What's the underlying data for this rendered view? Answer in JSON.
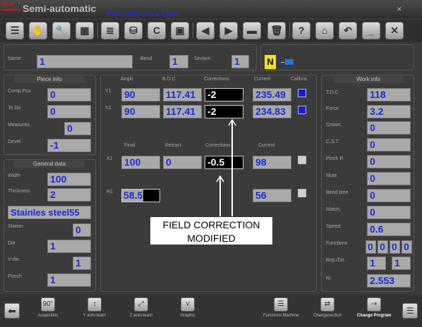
{
  "app": {
    "logo_text": "esa",
    "title": "Semi-automatic",
    "program": "PM0000 Press Start"
  },
  "toolbar": {
    "buttons": [
      "document-icon",
      "hand-icon",
      "wrench-icon",
      "calendar-icon",
      "list-icon",
      "database-icon",
      "c-icon",
      "save-icon",
      "arrow-left-icon",
      "arrow-right-icon",
      "minus-icon",
      "trash-icon",
      "help-icon",
      "home-icon",
      "undo-icon",
      "minimize-icon",
      "close-icon"
    ]
  },
  "header": {
    "name_label": "Name",
    "name_value": "1",
    "bend_label": "Bend",
    "bend_value": "1",
    "section_label": "Section",
    "section_value": "1",
    "mode_badge": "N"
  },
  "piece_info": {
    "title": "Piece info",
    "comp_pcs_label": "Comp.Pcs",
    "comp_pcs_value": "0",
    "to_do_label": "To Do",
    "to_do_value": "0",
    "measures_label": "Measures",
    "measures_value": "0",
    "devel_label": "Devel.",
    "devel_value": "-1"
  },
  "general_data": {
    "title": "General data",
    "width_label": "Width",
    "width_value": "100",
    "thickness_label": "Thickness",
    "thickness_value": "2",
    "material_value": "Stainles steel55",
    "station_label": "Station",
    "station_value": "0",
    "die_label": "Die",
    "die_value": "1",
    "vdie_label": "V-die",
    "vdie_value": "1",
    "punch_label": "Punch",
    "punch_value": "1"
  },
  "axes": {
    "col_angle": "Angle",
    "col_bdc": "B.D.C.",
    "col_corrections": "Corrections",
    "col_current": "Current",
    "col_calibra": "Calibra.",
    "y1_label": "Y1",
    "y1_angle": "90",
    "y1_bdc": "117.41",
    "y1_corr": "-2",
    "y1_current": "235.49",
    "y2_label": "Y2",
    "y2_angle": "90",
    "y2_bdc": "117.41",
    "y2_corr": "-2",
    "y2_current": "234.83",
    "col_final": "Final",
    "col_retract": "Retract",
    "col_corrections2": "Corrections",
    "col_current2": "Current",
    "x1_label": "X1",
    "x1_final": "100",
    "x1_retract": "0",
    "x1_corr": "-0.5",
    "x1_current": "98",
    "r1_label": "R1",
    "r1_final": "58.5",
    "r1_current": "56"
  },
  "annotation": {
    "line1": "FIELD CORRECTION",
    "line2": "MODIFIED"
  },
  "work_info": {
    "title": "Work info",
    "tdc_label": "T.D.C.",
    "tdc_value": "118",
    "force_label": "Force",
    "force_value": "3.2",
    "crown_label": "Crown.",
    "crown_value": "0",
    "cst_label": "C.S.T.",
    "cst_value": "0",
    "pinch_label": "Pinch P.",
    "pinch_value": "0",
    "mute_label": "Mute",
    "mute_value": "0",
    "bend_time_label": "Bend time",
    "bend_time_value": "0",
    "match_label": "Match.",
    "match_value": "0",
    "speed_label": "Speed",
    "speed_value": "0.6",
    "functions_label": "Functions",
    "functions_values": [
      "0",
      "0",
      "0",
      "0"
    ],
    "rep_label": "Rep./Dir.",
    "rep_value": "1",
    "dir_value": "1",
    "ri_label": "Ri",
    "ri_value": "2.553"
  },
  "bottom": {
    "acquisition": "Acquisition",
    "y_auto_learn": "Y auto-learn",
    "z_auto_learn": "Z auto-learn",
    "graphic": "Graphic",
    "functions_machine": "Functions Machine",
    "change_section": "Changesection",
    "change_program": "Change Program",
    "acquisition_icon_text": "90°"
  },
  "colors": {
    "value_blue": "#1b2fd6",
    "badge_yellow": "#f2e600",
    "calibra_blue": "#1a1adc"
  }
}
